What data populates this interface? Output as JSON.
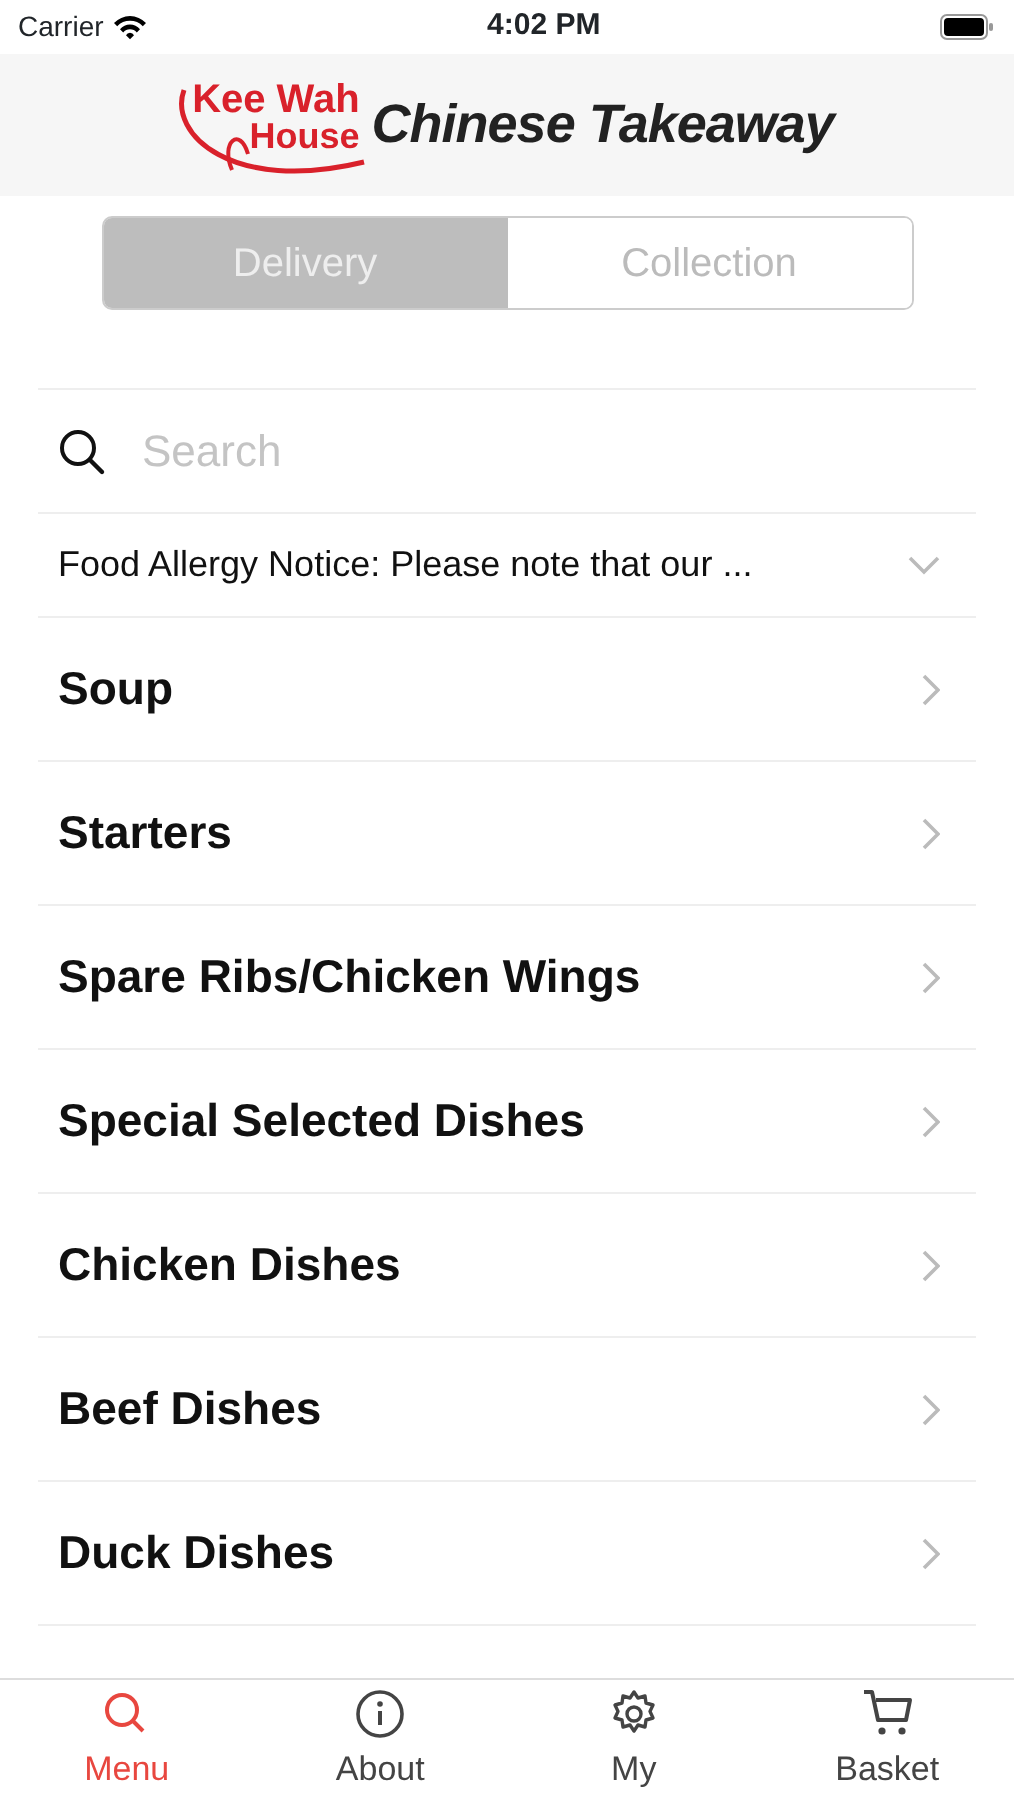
{
  "status_bar": {
    "carrier": "Carrier",
    "time": "4:02 PM"
  },
  "header": {
    "logo_top": "Kee Wah",
    "logo_bottom": "House",
    "title": "Chinese Takeaway"
  },
  "segments": [
    {
      "label": "Delivery",
      "selected": true
    },
    {
      "label": "Collection",
      "selected": false
    }
  ],
  "search": {
    "placeholder": "Search"
  },
  "notice": {
    "text": "Food Allergy Notice: Please note that our ...",
    "expanded": false
  },
  "categories": [
    {
      "label": "Soup"
    },
    {
      "label": "Starters"
    },
    {
      "label": "Spare Ribs/Chicken Wings"
    },
    {
      "label": "Special Selected Dishes"
    },
    {
      "label": "Chicken Dishes"
    },
    {
      "label": "Beef Dishes"
    },
    {
      "label": "Duck Dishes"
    }
  ],
  "tab_bar": [
    {
      "label": "Menu",
      "kind": "search",
      "selected": true
    },
    {
      "label": "About",
      "kind": "info",
      "selected": false
    },
    {
      "label": "My",
      "kind": "gear",
      "selected": false
    },
    {
      "label": "Basket",
      "kind": "cart",
      "selected": false
    }
  ]
}
